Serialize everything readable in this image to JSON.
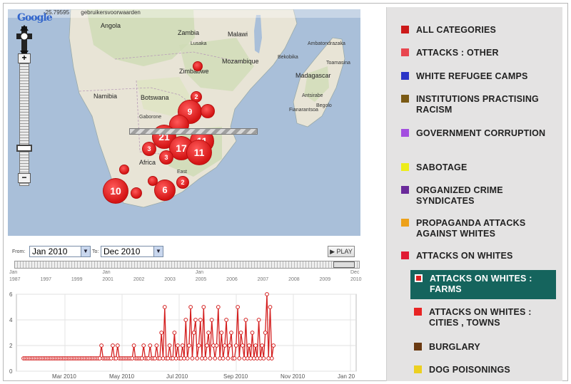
{
  "map": {
    "coord_text": "-25.79595",
    "coord_suffix": "gebruikersvoorwaarden",
    "google_logo": "Google",
    "labels": {
      "angola": "Angola",
      "zambia": "Zambia",
      "malawi": "Malawi",
      "mozambique": "Mozambique",
      "zimbabwe": "Zimbabwe",
      "namibia": "Namibia",
      "botswana": "Botswana",
      "madagascar": "Madagascar",
      "africa": "Africa",
      "gaborone": "Gaborone",
      "east": "East",
      "lusaka": "Lusaka",
      "toamasina": "Toamasina",
      "ambatondrazaka": "Ambatondrazaka",
      "antsirabe": "Antsirabe",
      "fianarantsoa": "Fianarantsoa",
      "beqolo": "Begolo",
      "bekobika": "Bekobika"
    },
    "markers": [
      {
        "label": "",
        "size": "small"
      },
      {
        "label": "2",
        "size": "small"
      },
      {
        "label": "9",
        "size": "large"
      },
      {
        "label": "21",
        "size": "large"
      },
      {
        "label": "11",
        "size": "large"
      },
      {
        "label": "17",
        "size": "large"
      },
      {
        "label": "11",
        "size": "large"
      },
      {
        "label": "3",
        "size": "small"
      },
      {
        "label": "3",
        "size": "small"
      },
      {
        "label": "10",
        "size": "large"
      },
      {
        "label": "6",
        "size": "medium"
      },
      {
        "label": "2",
        "size": "small"
      },
      {
        "label": "",
        "size": "small"
      },
      {
        "label": "",
        "size": "small"
      },
      {
        "label": "",
        "size": "small"
      }
    ],
    "zoom_in": "+",
    "zoom_out": "−"
  },
  "controls": {
    "from_label": "From:",
    "from_value": "Jan 2010",
    "to_label": "To:",
    "to_value": "Dec 2010",
    "play_label": "PLAY"
  },
  "timeline": {
    "ticks": [
      {
        "top": "Jan",
        "bottom": "1987"
      },
      {
        "top": "",
        "bottom": "1997"
      },
      {
        "top": "",
        "bottom": "1999"
      },
      {
        "top": "Jan",
        "bottom": "2001"
      },
      {
        "top": "",
        "bottom": "2002"
      },
      {
        "top": "",
        "bottom": "2003"
      },
      {
        "top": "Jan",
        "bottom": "2005"
      },
      {
        "top": "",
        "bottom": "2006"
      },
      {
        "top": "",
        "bottom": "2007"
      },
      {
        "top": "",
        "bottom": "2008"
      },
      {
        "top": "",
        "bottom": "2009"
      },
      {
        "top": "Dec",
        "bottom": "2010"
      }
    ]
  },
  "chart_data": {
    "type": "line",
    "xlabel": "",
    "ylabel": "",
    "ylim": [
      0,
      6
    ],
    "yticks": [
      "0",
      "2",
      "4",
      "6"
    ],
    "xticks": [
      "Mar 2010",
      "May 2010",
      "Jul 2010",
      "Sep 2010",
      "Nov 2010",
      "Jan 20"
    ],
    "series_color": "#d42020",
    "x": [
      0,
      2,
      4,
      6,
      8,
      10,
      12,
      14,
      16,
      18,
      20,
      22,
      24,
      26,
      28,
      30,
      32,
      34,
      36,
      38,
      40,
      42,
      44,
      46,
      48,
      50,
      52,
      54,
      56,
      58,
      60,
      62,
      64,
      66,
      68,
      70,
      72,
      74,
      76,
      78,
      80,
      82,
      84,
      86,
      88,
      90,
      92,
      94,
      96,
      98,
      100,
      102,
      104,
      106,
      108,
      110,
      112,
      114,
      116,
      118,
      120,
      122,
      124,
      126,
      128,
      130,
      132,
      134,
      136,
      138,
      140,
      142,
      144,
      146,
      148,
      150,
      152,
      154,
      156,
      158,
      160,
      162,
      164,
      166,
      168,
      170,
      172,
      174,
      176,
      178,
      180,
      182,
      184,
      186,
      188,
      190,
      192,
      194,
      196,
      198,
      200,
      202,
      204,
      206,
      208,
      210,
      212,
      214,
      216,
      218,
      220,
      222,
      224,
      226,
      228,
      230,
      232,
      234,
      236,
      238,
      240,
      242,
      244,
      246,
      248,
      250,
      252,
      254,
      256,
      258,
      260,
      262,
      264,
      266,
      268,
      270,
      272,
      274,
      276,
      278,
      280,
      282,
      284,
      286,
      288,
      290,
      292,
      294,
      296,
      298,
      300,
      302,
      304,
      306,
      308
    ],
    "values": [
      1,
      1,
      1,
      1,
      1,
      1,
      1,
      1,
      1,
      1,
      1,
      1,
      1,
      1,
      1,
      1,
      1,
      1,
      1,
      1,
      1,
      1,
      1,
      1,
      1,
      1,
      1,
      1,
      1,
      1,
      1,
      1,
      1,
      1,
      1,
      1,
      1,
      1,
      1,
      1,
      1,
      1,
      1,
      1,
      1,
      1,
      1,
      1,
      2,
      1,
      1,
      1,
      1,
      1,
      1,
      2,
      1,
      1,
      2,
      1,
      1,
      1,
      1,
      1,
      1,
      1,
      1,
      1,
      2,
      1,
      1,
      1,
      1,
      1,
      2,
      1,
      1,
      1,
      2,
      1,
      1,
      1,
      2,
      1,
      1,
      3,
      1,
      5,
      1,
      1,
      2,
      1,
      1,
      3,
      1,
      2,
      1,
      1,
      2,
      1,
      4,
      1,
      2,
      5,
      1,
      3,
      4,
      1,
      2,
      4,
      1,
      5,
      1,
      2,
      3,
      1,
      4,
      2,
      1,
      2,
      5,
      1,
      3,
      1,
      2,
      4,
      1,
      2,
      3,
      1,
      1,
      2,
      5,
      1,
      3,
      2,
      1,
      4,
      1,
      2,
      1,
      3,
      1,
      2,
      1,
      4,
      1,
      2,
      1,
      3,
      6,
      1,
      5,
      1,
      2,
      3,
      1,
      4,
      2,
      1,
      2,
      1,
      3,
      1,
      1
    ]
  },
  "legend": {
    "items": [
      {
        "label": "ALL CATEGORIES",
        "color": "#cc1a1a"
      },
      {
        "label": "ATTACKS : OTHER",
        "color": "#e8464f"
      },
      {
        "label": "WHITE REFUGEE CAMPS",
        "color": "#2b35c7"
      },
      {
        "label": "INSTITUTIONS PRACTISING RACISM",
        "color": "#7a5a14"
      },
      {
        "label": "GOVERNMENT CORRUPTION",
        "color": "#a34ee0"
      },
      {
        "label": "SABOTAGE",
        "color": "#eded1a"
      },
      {
        "label": "ORGANIZED CRIME SYNDICATES",
        "color": "#6a2a9a"
      },
      {
        "label": "PROPAGANDA ATTACKS AGAINST WHITES",
        "color": "#eda11a"
      },
      {
        "label": "ATTACKS ON WHITES",
        "color": "#e01b33"
      },
      {
        "label": "ATTACKS ON WHITES : FARMS",
        "color": "#d92020"
      },
      {
        "label": "ATTACKS ON WHITES : CITIES , TOWNS",
        "color": "#e82424"
      },
      {
        "label": "BURGLARY",
        "color": "#6a3a12"
      },
      {
        "label": "DOG POISONINGS",
        "color": "#ecd021"
      }
    ]
  }
}
